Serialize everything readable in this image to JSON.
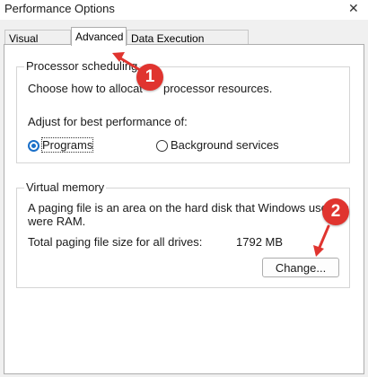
{
  "window": {
    "title": "Performance Options",
    "close_glyph": "✕"
  },
  "tabs": [
    {
      "label": "Visual Effects",
      "active": false
    },
    {
      "label": "Advanced",
      "active": true
    },
    {
      "label": "Data Execution Prevention",
      "active": false
    }
  ],
  "processor": {
    "group_label": "Processor scheduling",
    "desc_part1": "Choose how to allocat",
    "desc_part2": "processor resources.",
    "adjust_label": "Adjust for best performance of:",
    "options": [
      {
        "label": "Programs",
        "selected": true
      },
      {
        "label": "Background services",
        "selected": false
      }
    ]
  },
  "virtual_memory": {
    "group_label": "Virtual memory",
    "desc_line1": "A paging file is an area on the hard disk that Windows uses as",
    "desc_line2": "were RAM.",
    "total_label": "Total paging file size for all drives:",
    "total_value": "1792 MB",
    "change_button": "Change..."
  },
  "annotations": {
    "badges": [
      "1",
      "2"
    ],
    "color": "#e0342f"
  }
}
